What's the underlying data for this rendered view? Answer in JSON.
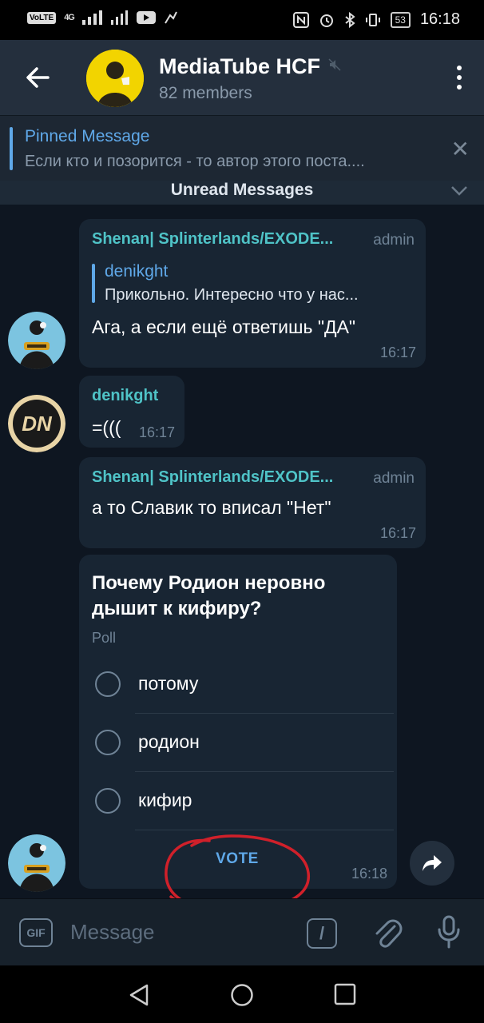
{
  "status_bar": {
    "volte": "VoLTE",
    "network": "4G",
    "battery": "53",
    "time": "16:18"
  },
  "header": {
    "title": "MediaTube HCF",
    "subtitle": "82 members"
  },
  "pinned": {
    "title": "Pinned Message",
    "text": "Если кто и позорится - то автор этого поста...."
  },
  "unread_label": "Unread Messages",
  "messages": [
    {
      "sender": "Shenan| Splinterlands/EXODE...",
      "badge": "admin",
      "reply": {
        "name": "denikght",
        "text": "Прикольно. Интересно что у нас..."
      },
      "text": "Ага, а если ещё ответишь \"ДА\"",
      "time": "16:17"
    },
    {
      "sender": "denikght",
      "text": "=(((",
      "time": "16:17"
    },
    {
      "sender": "Shenan| Splinterlands/EXODE...",
      "badge": "admin",
      "text": "а то Славик то вписал \"Нет\"",
      "time": "16:17"
    }
  ],
  "poll": {
    "question": "Почему Родион неровно дышит к кифиру?",
    "type": "Poll",
    "options": [
      "потому",
      "родион",
      "кифир"
    ],
    "vote_label": "VOTE",
    "time": "16:18"
  },
  "composer": {
    "gif_label": "GIF",
    "placeholder": "Message",
    "command_label": "/"
  },
  "colors": {
    "chat_bg": "#0e1621",
    "bubble": "#182533",
    "accent": "#5fa8e8",
    "sender": "#4fc3c7",
    "annotation": "#d0202a"
  }
}
